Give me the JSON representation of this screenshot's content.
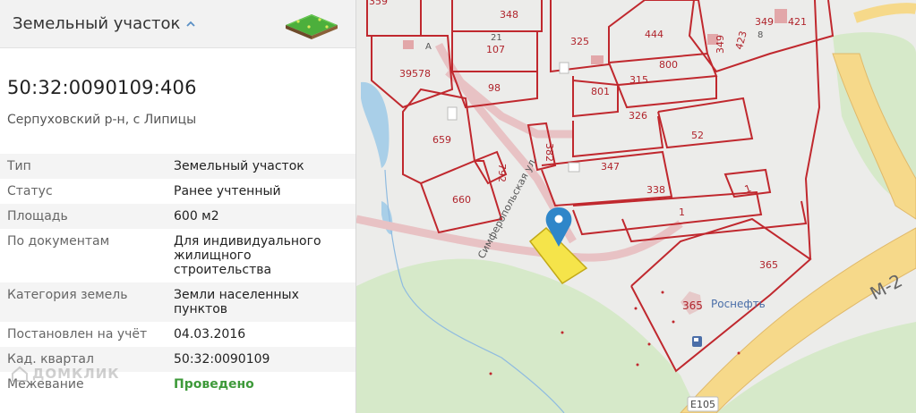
{
  "panel": {
    "title": "Земельный участок",
    "cadastral_number": "50:32:0090109:406",
    "address": "Серпуховский р-н, с Липицы",
    "rows": [
      {
        "key": "Тип",
        "value": "Земельный участок"
      },
      {
        "key": "Статус",
        "value": "Ранее учтенный"
      },
      {
        "key": "Площадь",
        "value": "600 м2"
      },
      {
        "key": "По документам",
        "value": "Для индивидуального жилищного строительства"
      },
      {
        "key": "Категория земель",
        "value": "Земли населенных пунктов"
      },
      {
        "key": "Постановлен на учёт",
        "value": "04.03.2016"
      },
      {
        "key": "Кад. квартал",
        "value": "50:32:0090109"
      },
      {
        "key": "Межевание",
        "value": "Проведено"
      }
    ],
    "watermark": "ДОМКЛИК"
  },
  "map": {
    "street": "Симферопольская ул.",
    "highway_m": "М-2",
    "highway_e": "E105",
    "poi": "Роснефть",
    "poi_plot": "365",
    "labels": {
      "p359": "359",
      "p348": "348",
      "p107": "107",
      "p21": "21",
      "p39578": "39578",
      "p98": "98",
      "p325": "325",
      "p444": "444",
      "p800": "800",
      "p801": "801",
      "p315": "315",
      "p349": "349",
      "p421": "421",
      "p423": "423",
      "p349b": "349",
      "p659": "659",
      "p792": "792",
      "p660": "660",
      "p382": "382",
      "p347": "347",
      "p326": "326",
      "p52": "52",
      "p338": "338",
      "p1a": "1",
      "p1b": "1",
      "p365": "365",
      "pA": "A",
      "pB": "8"
    },
    "colors": {
      "boundary": "#c0282e",
      "selected_fill": "#f5e44a",
      "pin": "#2f86c9",
      "road": "#f6d98a",
      "green": "#d3e8c6",
      "water": "#a9cfe8"
    }
  }
}
